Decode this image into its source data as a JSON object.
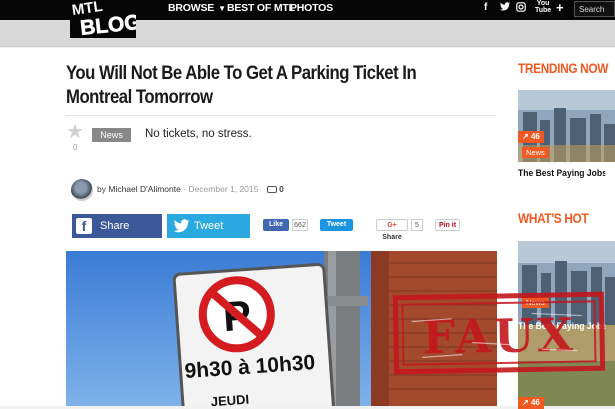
{
  "header": {
    "logo_text": "MTLBLOG",
    "nav": [
      {
        "label": "BROWSE"
      },
      {
        "label": "BEST OF MTL"
      },
      {
        "label": "PHOTOS"
      }
    ],
    "social": {
      "facebook": "f",
      "twitter": "t",
      "instagram": "o",
      "youtube": "You Tube",
      "more": "+"
    },
    "search_value": "Search"
  },
  "article": {
    "title": "You Will Not Be Able To Get A Parking Ticket In Montreal Tomorrow",
    "star_count": "0",
    "tag": "News",
    "subtitle": "No tickets, no stress.",
    "byline_prefix": "by",
    "author": "Michael D'Alimonte",
    "date": "December 1, 2015",
    "comment_count": "0"
  },
  "share": {
    "facebook_label": "Share",
    "twitter_label": "Tweet",
    "fb_like": "Like",
    "fb_like_count": "662",
    "tweet_small": "Tweet",
    "gplus_share": "Share",
    "gplus_count": "5",
    "pin_it": "Pin it"
  },
  "photo_sign": {
    "letter": "P",
    "hours": "9h30 à 10h30",
    "day": "JEUDI"
  },
  "sidebar": {
    "trending_heading": "TRENDING NOW",
    "trending_item": {
      "badge_count": "46",
      "category": "News",
      "title": "The Best Paying Jobs In C"
    },
    "hot_heading": "WHAT'S HOT",
    "hot_item": {
      "category": "News",
      "title": "The Best Paying Jobs In C",
      "badge_count": "46"
    }
  },
  "stamp_text": "FAUX",
  "colors": {
    "accent": "#f05a22",
    "facebook": "#3b5998",
    "twitter": "#2aa9e0",
    "stamp": "#c4161c"
  }
}
